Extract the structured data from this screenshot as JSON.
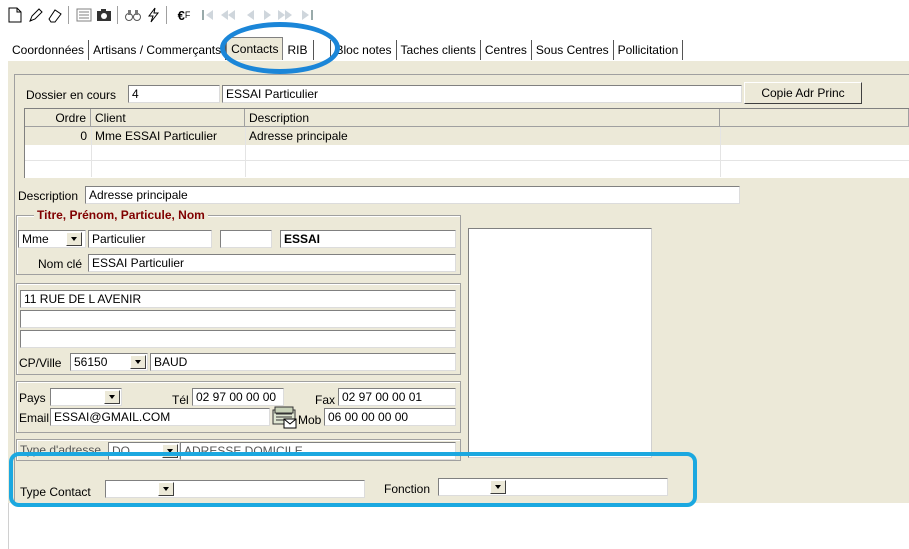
{
  "toolbar": {
    "icons": [
      "new-document-icon",
      "pencil-icon",
      "eraser-icon",
      "list-icon",
      "camera-icon",
      "binoculars-icon",
      "lightning-icon",
      "euro-icon",
      "first-record-icon",
      "previous-page-icon",
      "previous-record-icon",
      "next-record-icon",
      "next-page-icon",
      "last-record-icon"
    ]
  },
  "tabs": [
    "Coordonnées",
    "Artisans / Commerçants",
    "Contacts",
    "RIB",
    "Bloc notes",
    "Taches clients",
    "Centres",
    "Sous Centres",
    "Pollicitation"
  ],
  "active_tab": "Contacts",
  "dossier": {
    "label": "Dossier en cours",
    "number": "4",
    "name": "ESSAI Particulier",
    "copy_button": "Copie Adr Princ"
  },
  "grid": {
    "headers": [
      "Ordre",
      "Client",
      "Description"
    ],
    "rows": [
      {
        "ordre": "0",
        "client": "Mme ESSAI Particulier",
        "description": "Adresse principale"
      }
    ]
  },
  "description": {
    "label": "Description",
    "value": "Adresse principale"
  },
  "identity": {
    "legend": "Titre, Prénom, Particule, Nom",
    "title": "Mme",
    "firstname": "Particulier",
    "particle": "",
    "lastname": "ESSAI",
    "keyname_label": "Nom clé",
    "keyname": "ESSAI Particulier"
  },
  "address": {
    "line1": "11 RUE DE L AVENIR",
    "line2": "",
    "line3": "",
    "cp_label": "CP/Ville",
    "cp": "56150",
    "city": "BAUD"
  },
  "contact": {
    "country_label": "Pays",
    "country": "",
    "tel_label": "Tél",
    "tel": "02 97 00 00 00",
    "fax_label": "Fax",
    "fax": "02 97 00 00 01",
    "email_label": "Email",
    "email": "ESSAI@GMAIL.COM",
    "mob_label": "Mob",
    "mob": "06 00 00 00 00"
  },
  "address_type": {
    "label": "Type d'adresse",
    "code": "DO",
    "value": "ADRESSE DOMICILE"
  },
  "type_contact": {
    "label": "Type Contact",
    "value": ""
  },
  "fonction": {
    "label": "Fonction",
    "value": ""
  },
  "colors": {
    "annotation_blue": "#1b86d8",
    "window_bg": "#ece9d8",
    "legend_red": "#800000"
  }
}
